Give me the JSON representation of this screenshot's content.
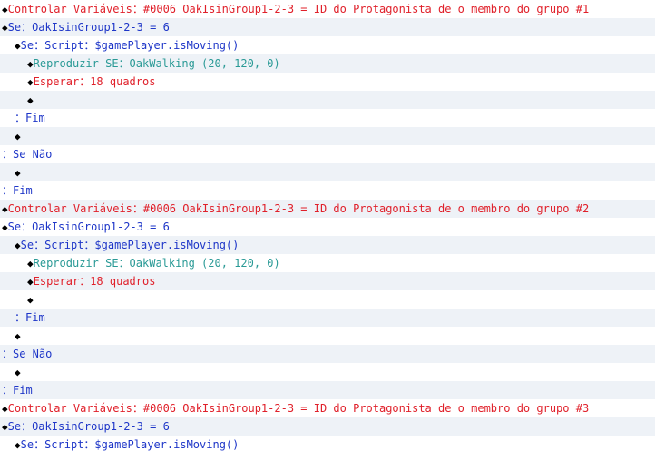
{
  "rows": [
    {
      "indent": 0,
      "diamond": true,
      "text": "Controlar Variáveis：#0006 OakIsinGroup1-2-3 = ID do Protagonista de o membro do grupo #1",
      "kind": "control-variables"
    },
    {
      "indent": 0,
      "diamond": true,
      "text": "Se：OakIsinGroup1-2-3 = 6",
      "kind": "if"
    },
    {
      "indent": 1,
      "diamond": true,
      "text": "Se：Script：$gamePlayer.isMoving()",
      "kind": "if"
    },
    {
      "indent": 2,
      "diamond": true,
      "text": "Reproduzir SE：OakWalking (20, 120, 0)",
      "kind": "play-se"
    },
    {
      "indent": 2,
      "diamond": true,
      "text": "Esperar：18 quadros",
      "kind": "wait"
    },
    {
      "indent": 2,
      "diamond": true,
      "text": "",
      "kind": "empty"
    },
    {
      "indent": 1,
      "diamond": false,
      "text": "：Fim",
      "kind": "end"
    },
    {
      "indent": 1,
      "diamond": true,
      "text": "",
      "kind": "empty"
    },
    {
      "indent": 0,
      "diamond": false,
      "text": "：Se Não",
      "kind": "else"
    },
    {
      "indent": 1,
      "diamond": true,
      "text": "",
      "kind": "empty"
    },
    {
      "indent": 0,
      "diamond": false,
      "text": "：Fim",
      "kind": "end"
    },
    {
      "indent": 0,
      "diamond": true,
      "text": "Controlar Variáveis：#0006 OakIsinGroup1-2-3 = ID do Protagonista de o membro do grupo #2",
      "kind": "control-variables"
    },
    {
      "indent": 0,
      "diamond": true,
      "text": "Se：OakIsinGroup1-2-3 = 6",
      "kind": "if"
    },
    {
      "indent": 1,
      "diamond": true,
      "text": "Se：Script：$gamePlayer.isMoving()",
      "kind": "if"
    },
    {
      "indent": 2,
      "diamond": true,
      "text": "Reproduzir SE：OakWalking (20, 120, 0)",
      "kind": "play-se"
    },
    {
      "indent": 2,
      "diamond": true,
      "text": "Esperar：18 quadros",
      "kind": "wait"
    },
    {
      "indent": 2,
      "diamond": true,
      "text": "",
      "kind": "empty"
    },
    {
      "indent": 1,
      "diamond": false,
      "text": "：Fim",
      "kind": "end"
    },
    {
      "indent": 1,
      "diamond": true,
      "text": "",
      "kind": "empty"
    },
    {
      "indent": 0,
      "diamond": false,
      "text": "：Se Não",
      "kind": "else"
    },
    {
      "indent": 1,
      "diamond": true,
      "text": "",
      "kind": "empty"
    },
    {
      "indent": 0,
      "diamond": false,
      "text": "：Fim",
      "kind": "end"
    },
    {
      "indent": 0,
      "diamond": true,
      "text": "Controlar Variáveis：#0006 OakIsinGroup1-2-3 = ID do Protagonista de o membro do grupo #3",
      "kind": "control-variables"
    },
    {
      "indent": 0,
      "diamond": true,
      "text": "Se：OakIsinGroup1-2-3 = 6",
      "kind": "if"
    },
    {
      "indent": 1,
      "diamond": true,
      "text": "Se：Script：$gamePlayer.isMoving()",
      "kind": "if"
    }
  ],
  "colors": {
    "control-variables": "#e0202a",
    "if": "#1e36c8",
    "play-se": "#2a9a96",
    "wait": "#e0202a",
    "end": "#1e36c8",
    "else": "#1e36c8",
    "empty": "#000000",
    "diamond": "#000000",
    "row_alt_bg": "#eef2f7"
  },
  "icons": {
    "bullet": "diamond-icon"
  }
}
